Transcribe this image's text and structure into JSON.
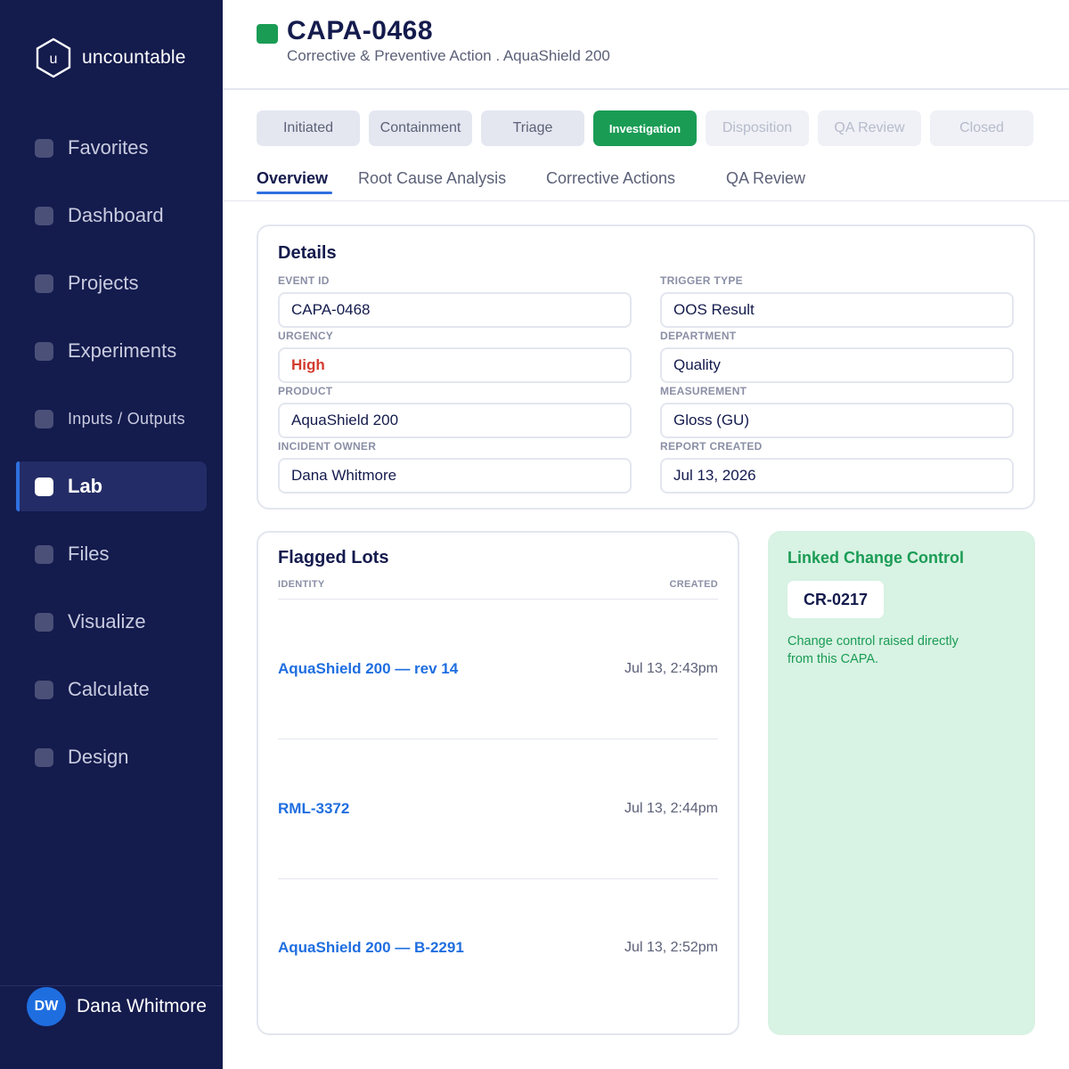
{
  "brand": {
    "logo_letter": "u",
    "name": "uncountable"
  },
  "sidebar": {
    "items": [
      {
        "label": "Favorites",
        "icon": "square-icon"
      },
      {
        "label": "Dashboard",
        "icon": "square-icon"
      },
      {
        "label": "Projects",
        "icon": "square-icon"
      },
      {
        "label": "Experiments",
        "icon": "square-icon"
      },
      {
        "label": "Inputs / Outputs",
        "icon": "square-icon"
      },
      {
        "label": "Lab",
        "icon": "square-icon",
        "active": true
      },
      {
        "label": "Files",
        "icon": "square-icon"
      },
      {
        "label": "Visualize",
        "icon": "square-icon"
      },
      {
        "label": "Calculate",
        "icon": "square-icon"
      },
      {
        "label": "Design",
        "icon": "square-icon"
      }
    ],
    "user": {
      "initials": "DW",
      "name": "Dana Whitmore"
    }
  },
  "header": {
    "title": "CAPA-0468",
    "subtitle": "Corrective & Preventive Action . AquaShield 200",
    "status_color": "#1a9c55"
  },
  "stepper": {
    "steps": [
      "Initiated",
      "Containment",
      "Triage",
      "Investigation",
      "Disposition",
      "QA Review",
      "Closed"
    ],
    "current": "Investigation"
  },
  "tabs": {
    "items": [
      "Overview",
      "Root Cause Analysis",
      "Corrective Actions",
      "QA Review"
    ],
    "active": "Overview"
  },
  "details": {
    "title": "Details",
    "fields": {
      "event_id": {
        "label": "EVENT ID",
        "value": "CAPA-0468"
      },
      "trigger_type": {
        "label": "TRIGGER TYPE",
        "value": "OOS Result"
      },
      "urgency": {
        "label": "URGENCY",
        "value": "High",
        "color": "#d23b2e"
      },
      "department": {
        "label": "DEPARTMENT",
        "value": "Quality"
      },
      "product": {
        "label": "PRODUCT",
        "value": "AquaShield 200"
      },
      "measurement": {
        "label": "MEASUREMENT",
        "value": "Gloss (GU)"
      },
      "incident_owner": {
        "label": "INCIDENT OWNER",
        "value": "Dana Whitmore"
      },
      "report_created": {
        "label": "REPORT CREATED",
        "value": "Jul 13, 2026"
      }
    }
  },
  "flagged_lots": {
    "title": "Flagged Lots",
    "columns": {
      "identity": "IDENTITY",
      "created": "CREATED"
    },
    "rows": [
      {
        "identity": "AquaShield 200 — rev 14",
        "created": "Jul 13, 2:43pm"
      },
      {
        "identity": "RML-3372",
        "created": "Jul 13, 2:44pm"
      },
      {
        "identity": "AquaShield 200 — B-2291",
        "created": "Jul 13, 2:52pm"
      }
    ]
  },
  "linked_change_control": {
    "title": "Linked Change Control",
    "id": "CR-0217",
    "note": "Change control raised directly from this CAPA."
  },
  "colors": {
    "sidebar_bg": "#141b4d",
    "accent_blue": "#1f6ee0",
    "success_green": "#1a9c55",
    "danger_red": "#d23b2e",
    "linked_bg": "#d8f2e3"
  }
}
